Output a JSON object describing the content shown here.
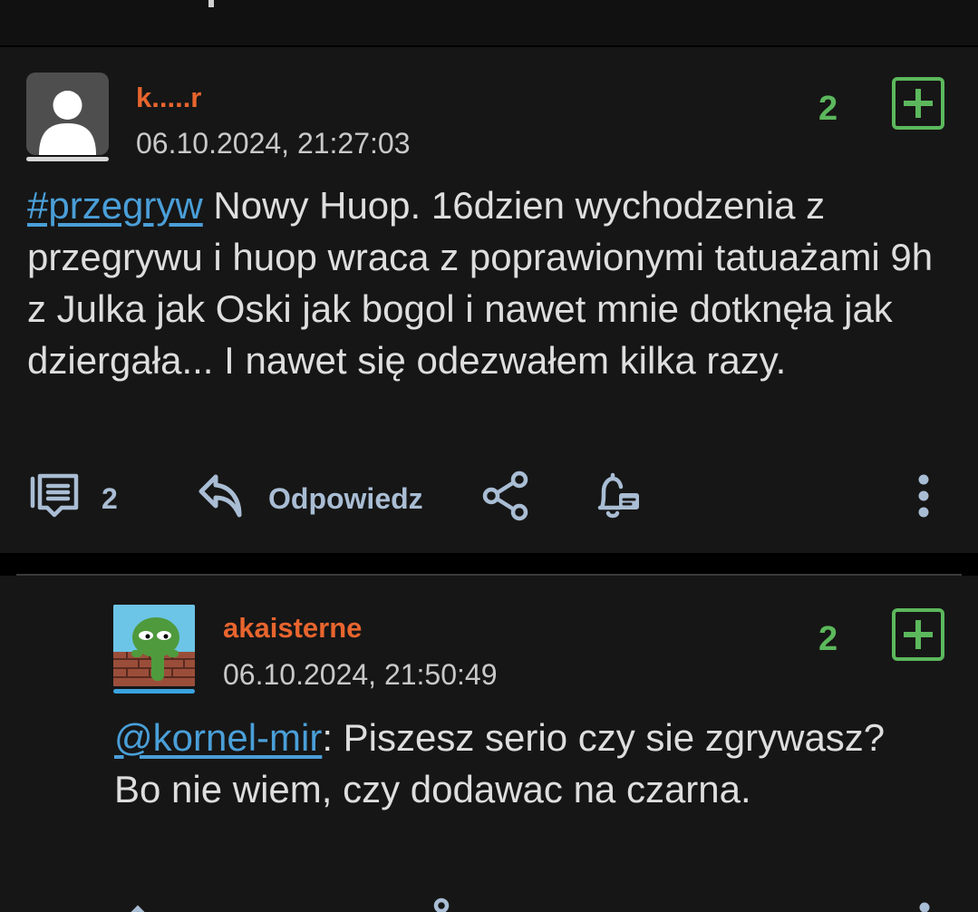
{
  "post": {
    "username": "k.....r",
    "timestamp": "06.10.2024, 21:27:03",
    "votes": "2",
    "body": {
      "hashtag": "#przegryw",
      "text": " Nowy Huop. 16dzien wychodzenia z przegrywu i huop wraca z poprawionymi tatuażami 9h z Julka jak Oski jak bogol i nawet mnie dotknęła jak dziergała... I nawet się odezwałem kilka razy."
    },
    "actions": {
      "comments_count": "2",
      "reply_label": "Odpowiedz"
    }
  },
  "reply": {
    "username": "akaisterne",
    "timestamp": "06.10.2024, 21:50:49",
    "votes": "2",
    "body": {
      "mention": "@kornel-mir",
      "text": ": Piszesz serio czy sie zgrywasz? Bo nie wiem, czy dodawac na czarna."
    }
  },
  "colors": {
    "background": "#161616",
    "username": "#e8652e",
    "votes": "#5cb85c",
    "link": "#4a9fd8",
    "action": "#a9bdd4"
  },
  "icons": [
    "comments-icon",
    "reply-arrow-icon",
    "share-icon",
    "notification-bell-icon",
    "more-vertical-icon",
    "plus-vote-icon",
    "user-placeholder-avatar",
    "frog-avatar"
  ]
}
